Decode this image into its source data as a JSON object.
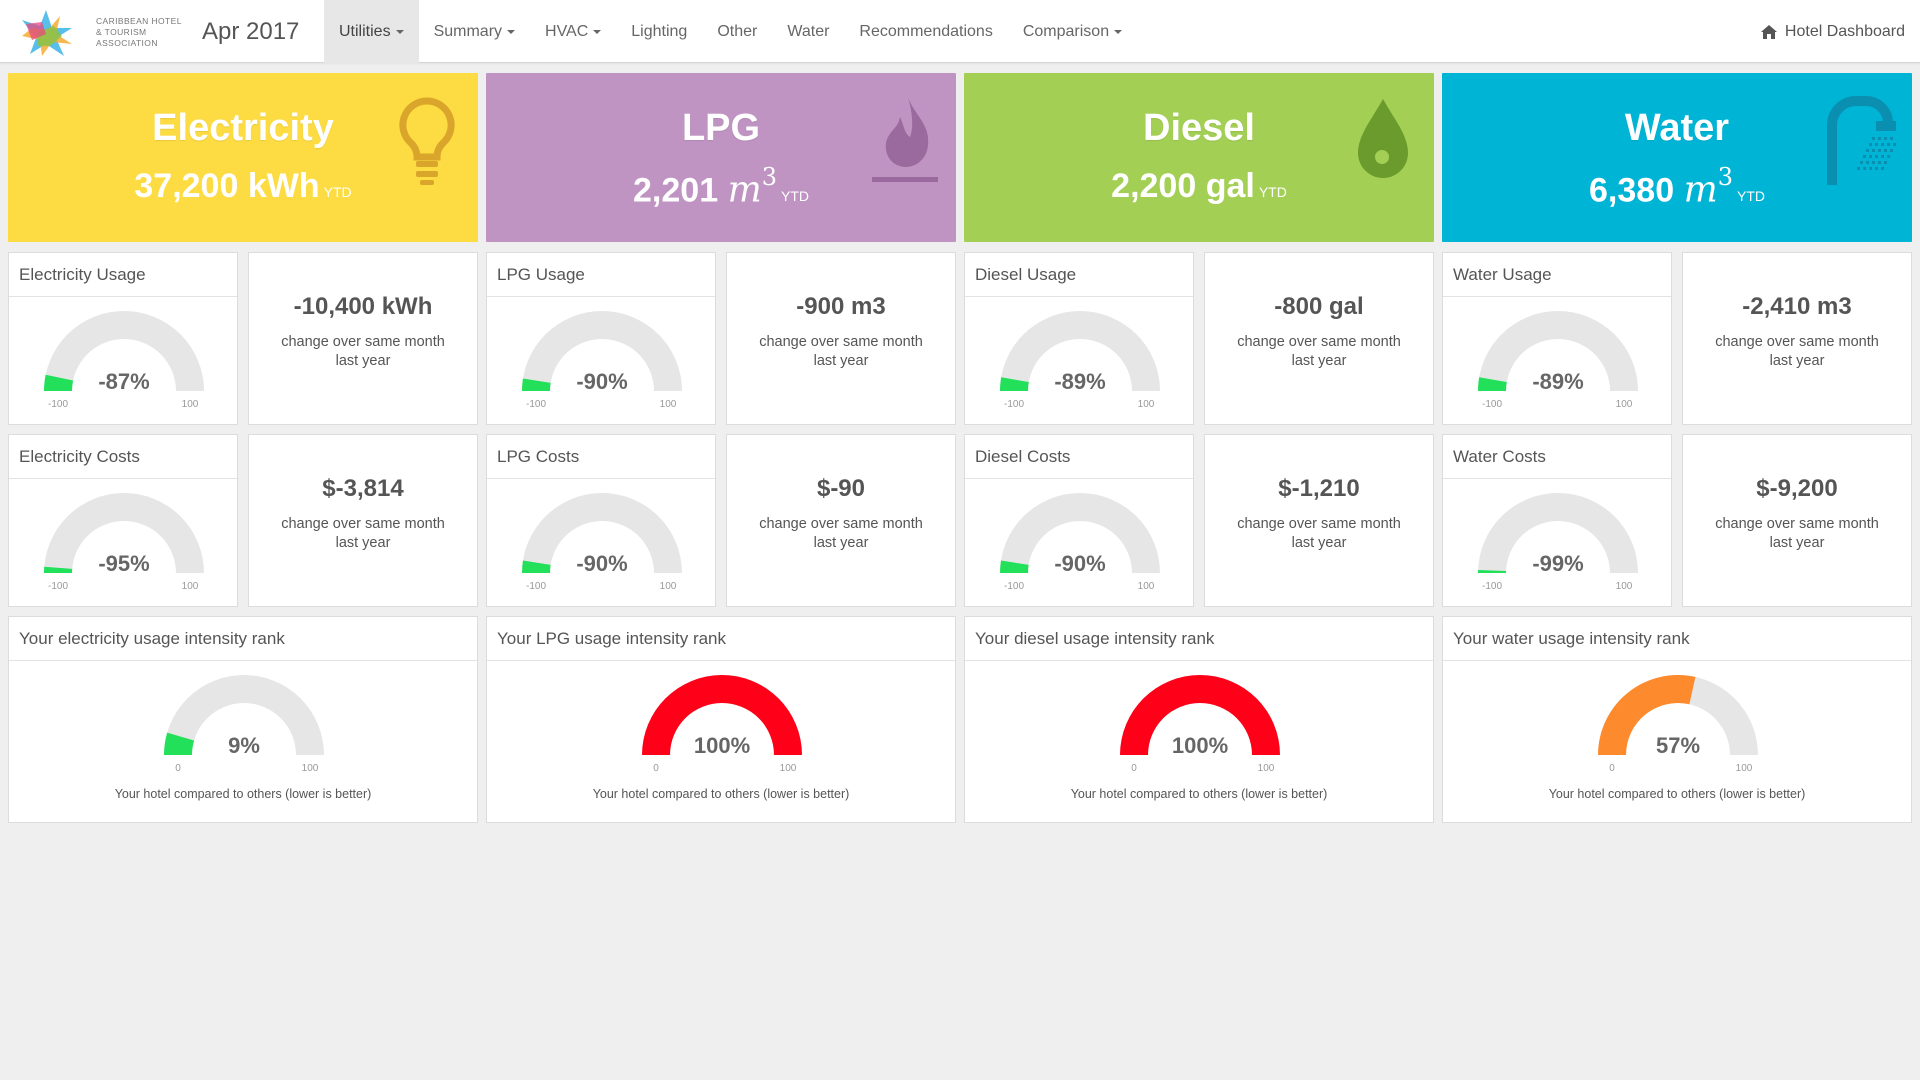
{
  "brand": {
    "text": "CARIBBEAN HOTEL & TOURISM ASSOCIATION",
    "date": "Apr 2017"
  },
  "nav": {
    "items": [
      {
        "label": "Utilities",
        "dropdown": true,
        "active": true
      },
      {
        "label": "Summary",
        "dropdown": true
      },
      {
        "label": "HVAC",
        "dropdown": true
      },
      {
        "label": "Lighting"
      },
      {
        "label": "Other"
      },
      {
        "label": "Water"
      },
      {
        "label": "Recommendations"
      },
      {
        "label": "Comparison",
        "dropdown": true
      }
    ],
    "right_label": "Hotel Dashboard"
  },
  "utilities": [
    {
      "key": "electricity",
      "color": "#fddb42",
      "icon": "lightbulb-icon",
      "title": "Electricity",
      "value": "37,200",
      "unit": "kWh",
      "ytd": "YTD",
      "usage": {
        "label": "Electricity Usage",
        "gauge": -87,
        "gauge_text": "-87%",
        "min": "-100",
        "max": "100",
        "change": "-10,400 kWh",
        "change_text": "change over same month last year"
      },
      "costs": {
        "label": "Electricity Costs",
        "gauge": -95,
        "gauge_text": "-95%",
        "min": "-100",
        "max": "100",
        "change": "$-3,814",
        "change_text": "change over same month last year"
      },
      "rank": {
        "label": "Your electricity usage intensity rank",
        "gauge": 9,
        "gauge_text": "9%",
        "min": "0",
        "max": "100",
        "color": "#22e05a",
        "caption": "Your hotel compared to others (lower is better)"
      }
    },
    {
      "key": "lpg",
      "color": "#bf94c2",
      "icon": "flame-icon",
      "title": "LPG",
      "value": "2,201",
      "unit": "m",
      "unit_sup": "3",
      "ytd": "YTD",
      "usage": {
        "label": "LPG Usage",
        "gauge": -90,
        "gauge_text": "-90%",
        "min": "-100",
        "max": "100",
        "change": "-900 m3",
        "change_text": "change over same month last year"
      },
      "costs": {
        "label": "LPG Costs",
        "gauge": -90,
        "gauge_text": "-90%",
        "min": "-100",
        "max": "100",
        "change": "$-90",
        "change_text": "change over same month last year"
      },
      "rank": {
        "label": "Your LPG usage intensity rank",
        "gauge": 100,
        "gauge_text": "100%",
        "min": "0",
        "max": "100",
        "color": "#ff0019",
        "caption": "Your hotel compared to others (lower is better)"
      }
    },
    {
      "key": "diesel",
      "color": "#a3cf55",
      "icon": "droplet-icon",
      "title": "Diesel",
      "value": "2,200",
      "unit": "gal",
      "ytd": "YTD",
      "usage": {
        "label": "Diesel Usage",
        "gauge": -89,
        "gauge_text": "-89%",
        "min": "-100",
        "max": "100",
        "change": "-800 gal",
        "change_text": "change over same month last year"
      },
      "costs": {
        "label": "Diesel Costs",
        "gauge": -90,
        "gauge_text": "-90%",
        "min": "-100",
        "max": "100",
        "change": "$-1,210",
        "change_text": "change over same month last year"
      },
      "rank": {
        "label": "Your diesel usage intensity rank",
        "gauge": 100,
        "gauge_text": "100%",
        "min": "0",
        "max": "100",
        "color": "#ff0019",
        "caption": "Your hotel compared to others (lower is better)"
      }
    },
    {
      "key": "water",
      "color": "#00b4d6",
      "icon": "shower-icon",
      "title": "Water",
      "value": "6,380",
      "unit": "m",
      "unit_sup": "3",
      "ytd": "YTD",
      "usage": {
        "label": "Water Usage",
        "gauge": -89,
        "gauge_text": "-89%",
        "min": "-100",
        "max": "100",
        "change": "-2,410 m3",
        "change_text": "change over same month last year"
      },
      "costs": {
        "label": "Water Costs",
        "gauge": -99,
        "gauge_text": "-99%",
        "min": "-100",
        "max": "100",
        "change": "$-9,200",
        "change_text": "change over same month last year"
      },
      "rank": {
        "label": "Your water usage intensity rank",
        "gauge": 57,
        "gauge_text": "57%",
        "min": "0",
        "max": "100",
        "color": "#fd8b2e",
        "caption": "Your hotel compared to others (lower is better)"
      }
    }
  ],
  "colors": {
    "gauge_bg": "#e6e6e6",
    "gauge_good": "#22e05a"
  }
}
